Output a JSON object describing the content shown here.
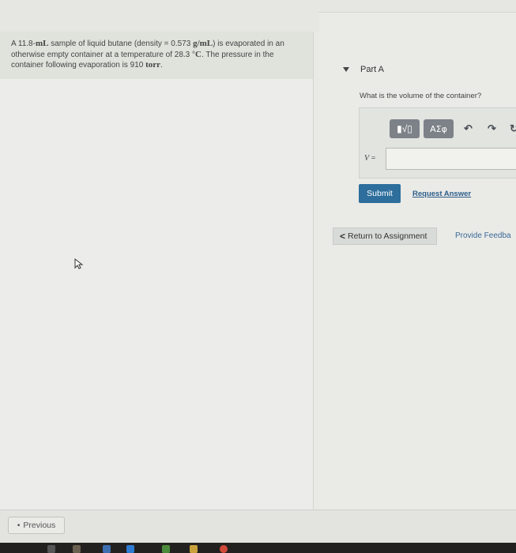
{
  "problem": {
    "seg1": "A 11.8-",
    "unit_ml": "mL",
    "seg2": " sample of liquid butane (density = 0.573 ",
    "unit_density": "g/mL",
    "seg3": ") is evaporated in an otherwise empty container at a temperature of 28.3 °",
    "unit_c": "C",
    "seg4": ". The pressure in the container following evaporation is 910 ",
    "unit_torr": "torr",
    "seg5": "."
  },
  "part": {
    "label": "Part A"
  },
  "question": "What is the volume of the container?",
  "toolbar": {
    "matrix_label": "▮√▯",
    "greek_label": "ΑΣφ",
    "undo_icon": "undo-icon",
    "redo_icon": "redo-icon",
    "refresh_icon": "refresh-icon"
  },
  "answer": {
    "var": "V",
    "eq": " = ",
    "value": ""
  },
  "buttons": {
    "submit": "Submit",
    "request": "Request Answer",
    "return": "Return to Assignment",
    "feedback": "Provide Feedba",
    "previous": "Previous"
  },
  "colors": {
    "submit": "#2d6e9c",
    "link": "#2b5d8a"
  }
}
